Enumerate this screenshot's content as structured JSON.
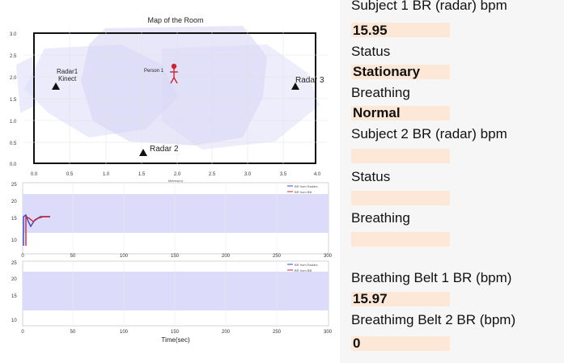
{
  "map": {
    "title": "Map of the Room",
    "x_ticks": [
      "0.0",
      "0.5",
      "1.0",
      "1.5",
      "2.0",
      "2.5",
      "3.0",
      "3.5",
      "4.0"
    ],
    "y_ticks": [
      "3.0",
      "2.5",
      "2.0",
      "1.5",
      "1.0",
      "0.5",
      "0.0"
    ],
    "radar1_label_line1": "Radar1",
    "radar1_label_line2": "Kinect",
    "radar2_label": "Radar 2",
    "radar3_label": "Radar 3",
    "person_label": "Person 1",
    "xlabel_small": "Metres(m)"
  },
  "subject1_chart": {
    "y_ticks": [
      "25",
      "20",
      "15",
      "10"
    ],
    "x_ticks": [
      "0",
      "50",
      "100",
      "150",
      "200",
      "250",
      "300"
    ],
    "legend_radar": "BR from Radars",
    "legend_belt": "BR from BB",
    "color_radar": "#3344cc",
    "color_belt": "#cc2233",
    "band_color": "#dcdcfa"
  },
  "subject2_chart": {
    "y_ticks": [
      "25",
      "20",
      "15",
      "10"
    ],
    "x_ticks": [
      "0",
      "50",
      "100",
      "150",
      "200",
      "250",
      "300"
    ],
    "legend_radar": "BR from Radars",
    "legend_belt": "BR from BB",
    "xlabel": "Time(sec)"
  },
  "panel": {
    "subject1_br_label": "Subject 1 BR (radar) bpm",
    "subject1_br_value": "15.95",
    "status1_label": "Status",
    "status1_value": "Stationary",
    "breathing1_label": "Breathing",
    "breathing1_value": "Normal",
    "subject2_br_label": "Subject 2 BR (radar) bpm",
    "subject2_br_value": "",
    "status2_label": "Status",
    "status2_value": "",
    "breathing2_label": "Breathing",
    "breathing2_value": "",
    "belt1_label": "Breathing Belt 1 BR (bpm)",
    "belt1_value": "15.97",
    "belt2_label": "Breathimg Belt 2 BR (bpm)",
    "belt2_value": "0"
  }
}
